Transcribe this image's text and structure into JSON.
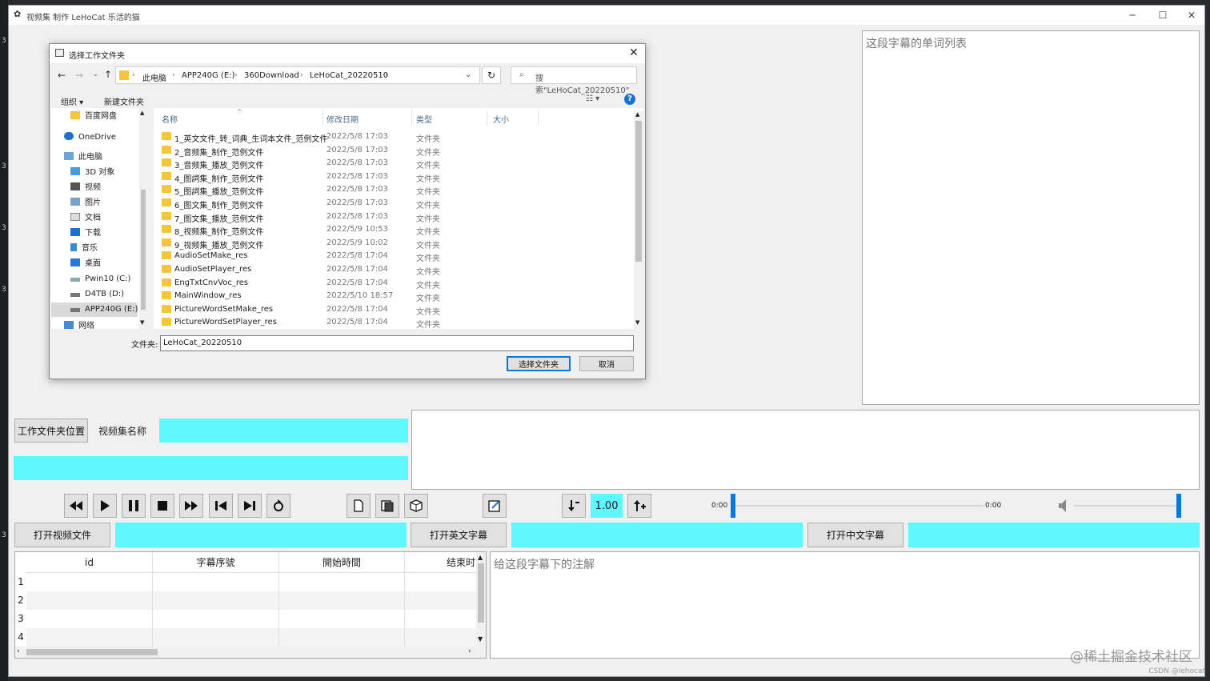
{
  "app": {
    "title": "视频集 制作  LeHoCat 乐活的猫",
    "window_controls": {
      "minimize": "─",
      "maximize": "☐",
      "close": "✕"
    }
  },
  "desktop_marks": [
    "3",
    "3",
    "3",
    "3",
    "3"
  ],
  "word_list": {
    "placeholder": "这段字幕的单词列表"
  },
  "workspace": {
    "folder_button": "工作文件夹位置",
    "set_name_label": "视频集名称",
    "set_name_value": "",
    "folder_path_value": ""
  },
  "player": {
    "speed": "1.00",
    "time_start": "0:00",
    "time_end": "0:00",
    "progress_fraction": 0,
    "volume_fraction": 1.0
  },
  "files": {
    "open_video": "打开视频文件",
    "open_english": "打开英文字幕",
    "open_chinese": "打开中文字幕"
  },
  "subtitle_table": {
    "columns": [
      "id",
      "字幕序號",
      "開始時間",
      "结束时"
    ],
    "rows": [
      "1",
      "2",
      "3",
      "4"
    ]
  },
  "annotation": {
    "placeholder": "给这段字幕下的注解"
  },
  "dialog": {
    "title": "选择工作文件夹",
    "breadcrumb": [
      "此电脑",
      "APP240G (E:)",
      "360Download",
      "LeHoCat_20220510"
    ],
    "search_placeholder": "搜索\"LeHoCat_20220510\"",
    "organize": "组织 ▾",
    "new_folder": "新建文件夹",
    "columns": {
      "name": "名称",
      "modified": "修改日期",
      "type": "类型",
      "size": "大小"
    },
    "nav_items": [
      {
        "label": "百度网盘",
        "icon": "folder-icon"
      },
      {
        "label": "OneDrive",
        "icon": "cloud-icon"
      },
      {
        "label": "此电脑",
        "icon": "computer-icon"
      },
      {
        "label": "3D 对象",
        "icon": "cube-icon"
      },
      {
        "label": "视频",
        "icon": "video-icon"
      },
      {
        "label": "图片",
        "icon": "picture-icon"
      },
      {
        "label": "文档",
        "icon": "document-icon"
      },
      {
        "label": "下载",
        "icon": "download-icon"
      },
      {
        "label": "音乐",
        "icon": "music-icon"
      },
      {
        "label": "桌面",
        "icon": "desktop-icon"
      },
      {
        "label": "Pwin10 (C:)",
        "icon": "drive-icon"
      },
      {
        "label": "D4TB (D:)",
        "icon": "drive-icon"
      },
      {
        "label": "APP240G (E:)",
        "icon": "drive-icon"
      },
      {
        "label": "网络",
        "icon": "network-icon"
      }
    ],
    "files": [
      {
        "name": "1_英文文件_转_词典_生词本文件_范例文件",
        "date": "2022/5/8 17:03",
        "type": "文件夹"
      },
      {
        "name": "2_音频集_制作_范例文件",
        "date": "2022/5/8 17:03",
        "type": "文件夹"
      },
      {
        "name": "3_音频集_播放_范例文件",
        "date": "2022/5/8 17:03",
        "type": "文件夹"
      },
      {
        "name": "4_图詞集_制作_范例文件",
        "date": "2022/5/8 17:03",
        "type": "文件夹"
      },
      {
        "name": "5_图詞集_播放_范例文件",
        "date": "2022/5/8 17:03",
        "type": "文件夹"
      },
      {
        "name": "6_图文集_制作_范例文件",
        "date": "2022/5/8 17:03",
        "type": "文件夹"
      },
      {
        "name": "7_图文集_播放_范例文件",
        "date": "2022/5/8 17:03",
        "type": "文件夹"
      },
      {
        "name": "8_视频集_制作_范例文件",
        "date": "2022/5/9 10:53",
        "type": "文件夹"
      },
      {
        "name": "9_视频集_播放_范例文件",
        "date": "2022/5/9 10:02",
        "type": "文件夹"
      },
      {
        "name": "AudioSetMake_res",
        "date": "2022/5/8 17:04",
        "type": "文件夹"
      },
      {
        "name": "AudioSetPlayer_res",
        "date": "2022/5/8 17:04",
        "type": "文件夹"
      },
      {
        "name": "EngTxtCnvVoc_res",
        "date": "2022/5/8 17:04",
        "type": "文件夹"
      },
      {
        "name": "MainWindow_res",
        "date": "2022/5/10 18:57",
        "type": "文件夹"
      },
      {
        "name": "PictureWordSetMake_res",
        "date": "2022/5/8 17:04",
        "type": "文件夹"
      },
      {
        "name": "PictureWordSetPlayer_res",
        "date": "2022/5/8 17:04",
        "type": "文件夹"
      }
    ],
    "folder_label": "文件夹:",
    "folder_value": "LeHoCat_20220510",
    "select_button": "选择文件夹",
    "cancel_button": "取消"
  },
  "watermark": "@稀土掘金技术社区",
  "watermark2": "CSDN @lehocat"
}
